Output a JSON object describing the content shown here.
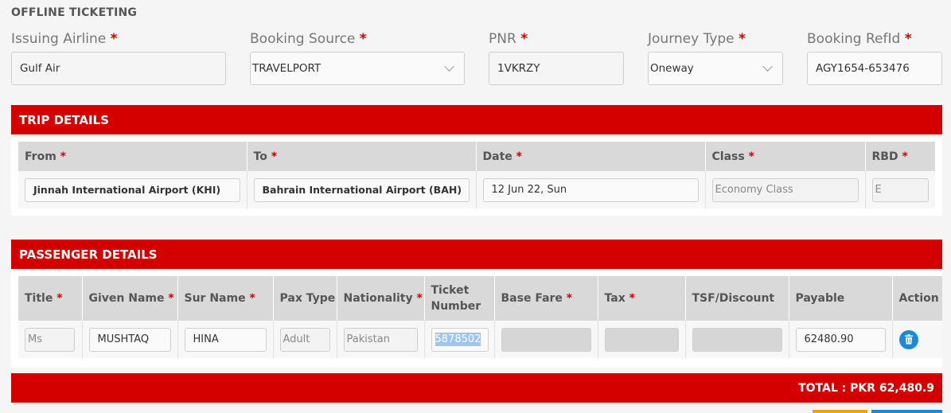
{
  "page_title": "OFFLINE TICKETING",
  "required_mark": "*",
  "top_fields": {
    "issuing_airline": {
      "label": "Issuing Airline",
      "value": "Gulf Air"
    },
    "booking_source": {
      "label": "Booking Source",
      "value": "TRAVELPORT"
    },
    "pnr": {
      "label": "PNR",
      "value": "1VKRZY"
    },
    "journey_type": {
      "label": "Journey Type",
      "value": "Oneway"
    },
    "booking_ref": {
      "label": "Booking RefId",
      "value": "AGY1654-653476"
    }
  },
  "trip": {
    "title": "TRIP DETAILS",
    "headers": {
      "from": "From",
      "to": "To",
      "date": "Date",
      "class": "Class",
      "rbd": "RBD"
    },
    "row": {
      "from": "Jinnah International Airport (KHI)",
      "to": "Bahrain International Airport (BAH)",
      "date": "12 Jun 22, Sun",
      "class": "Economy Class",
      "rbd": "E"
    }
  },
  "passenger": {
    "title": "PASSENGER DETAILS",
    "headers": {
      "title": "Title",
      "given_name": "Given Name",
      "sur_name": "Sur Name",
      "pax_type": "Pax Type",
      "nationality": "Nationality",
      "ticket_number_1": "Ticket",
      "ticket_number_2": "Number",
      "base_fare": "Base Fare",
      "tax": "Tax",
      "tsf": "TSF/Discount",
      "payable": "Payable",
      "action": "Action"
    },
    "row": {
      "title": "Ms",
      "given_name": "MUSHTAQ",
      "sur_name": "HINA",
      "pax_type": "Adult",
      "nationality": "Pakistan",
      "ticket_number": "5878502",
      "base_fare": "",
      "tax": "",
      "tsf": "",
      "payable": "62480.90"
    }
  },
  "total": "TOTAL : PKR 62,480.9",
  "colors": {
    "accent": "#d40000",
    "action_blue": "#1e88d8",
    "strip_orange": "#f0a500"
  },
  "icons": {
    "delete": "trash-icon",
    "dropdown": "chevron-down-icon"
  }
}
